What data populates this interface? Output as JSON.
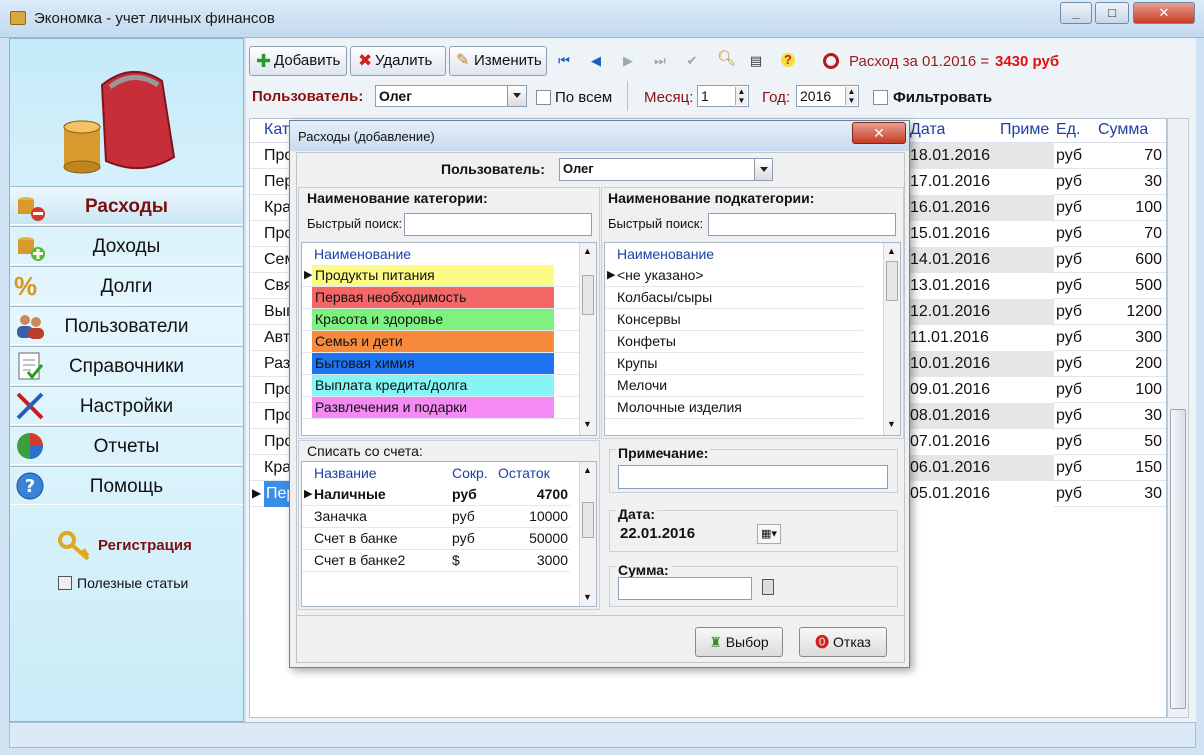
{
  "window": {
    "title": "Экономка - учет личных финансов",
    "min": "_",
    "max": "□",
    "close": "✕"
  },
  "sidebar": {
    "items": [
      {
        "label": "Расходы",
        "icon": "coins-minus-icon"
      },
      {
        "label": "Доходы",
        "icon": "coins-plus-icon"
      },
      {
        "label": "Долги",
        "icon": "percent-icon"
      },
      {
        "label": "Пользователи",
        "icon": "users-icon"
      },
      {
        "label": "Справочники",
        "icon": "checklist-icon"
      },
      {
        "label": "Настройки",
        "icon": "tools-icon"
      },
      {
        "label": "Отчеты",
        "icon": "pie-chart-icon"
      },
      {
        "label": "Помощь",
        "icon": "help-icon"
      }
    ],
    "register": "Регистрация",
    "articles": "Полезные статьи"
  },
  "toolbar": {
    "add": "Добавить",
    "delete": "Удалить",
    "edit": "Изменить",
    "summary_prefix": "Расход за 01.2016 =",
    "summary_value": "3430 руб"
  },
  "filter": {
    "user_label": "Пользователь:",
    "user_value": "Олег",
    "all_label": "По всем",
    "month_label": "Месяц:",
    "month_value": "1",
    "year_label": "Год:",
    "year_value": "2016",
    "filter_label": "Фильтровать"
  },
  "grid": {
    "columns": [
      "Кат",
      "Дата",
      "Приме",
      "Ед.",
      "Сумма"
    ],
    "rows": [
      {
        "cat": "Про",
        "date": "18.01.2016",
        "unit": "руб",
        "sum": "70"
      },
      {
        "cat": "Пер",
        "date": "17.01.2016",
        "unit": "руб",
        "sum": "30"
      },
      {
        "cat": "Кра",
        "date": "16.01.2016",
        "unit": "руб",
        "sum": "100"
      },
      {
        "cat": "Про",
        "date": "15.01.2016",
        "unit": "руб",
        "sum": "70"
      },
      {
        "cat": "Сем",
        "date": "14.01.2016",
        "unit": "руб",
        "sum": "600"
      },
      {
        "cat": "Свя",
        "date": "13.01.2016",
        "unit": "руб",
        "sum": "500"
      },
      {
        "cat": "Вып",
        "date": "12.01.2016",
        "unit": "руб",
        "sum": "1200"
      },
      {
        "cat": "Авт",
        "date": "11.01.2016",
        "unit": "руб",
        "sum": "300"
      },
      {
        "cat": "Раз",
        "date": "10.01.2016",
        "unit": "руб",
        "sum": "200"
      },
      {
        "cat": "Про",
        "date": "09.01.2016",
        "unit": "руб",
        "sum": "100"
      },
      {
        "cat": "Про",
        "date": "08.01.2016",
        "unit": "руб",
        "sum": "30"
      },
      {
        "cat": "Про",
        "date": "07.01.2016",
        "unit": "руб",
        "sum": "50"
      },
      {
        "cat": "Кра",
        "date": "06.01.2016",
        "unit": "руб",
        "sum": "150"
      },
      {
        "cat": "Пер",
        "date": "05.01.2016",
        "unit": "руб",
        "sum": "30"
      }
    ]
  },
  "dialog": {
    "title": "Расходы (добавление)",
    "user_label": "Пользователь:",
    "user_value": "Олег",
    "category_title": "Наименование категории:",
    "subcategory_title": "Наименование подкатегории:",
    "quick_search": "Быстрый поиск:",
    "name_header": "Наименование",
    "categories": [
      {
        "label": "Продукты питания",
        "color": "#fbfb85"
      },
      {
        "label": "Первая необходимость",
        "color": "#f46767"
      },
      {
        "label": "Красота и здоровье",
        "color": "#7ef27e"
      },
      {
        "label": "Семья и дети",
        "color": "#f88a3c"
      },
      {
        "label": "Бытовая химия",
        "color": "#1e74f0"
      },
      {
        "label": "Выплата кредита/долга",
        "color": "#86f5f5"
      },
      {
        "label": "Развлечения и подарки",
        "color": "#f58af5"
      }
    ],
    "subcategories": [
      "<не указано>",
      "Колбасы/сыры",
      "Консервы",
      "Конфеты",
      "Крупы",
      "Мелочи",
      "Молочные изделия"
    ],
    "account_title": "Списать со счета:",
    "account_cols": [
      "Название",
      "Сокр.",
      "Остаток"
    ],
    "accounts": [
      {
        "name": "Наличные",
        "short": "руб",
        "balance": "4700"
      },
      {
        "name": "Заначка",
        "short": "руб",
        "balance": "10000"
      },
      {
        "name": "Счет в банке",
        "short": "руб",
        "balance": "50000"
      },
      {
        "name": "Счет в банке2",
        "short": "$",
        "balance": "3000"
      }
    ],
    "note_label": "Примечание:",
    "date_label": "Дата:",
    "date_value": "22.01.2016",
    "sum_label": "Сумма:",
    "ok": "Выбор",
    "cancel": "Отказ"
  }
}
